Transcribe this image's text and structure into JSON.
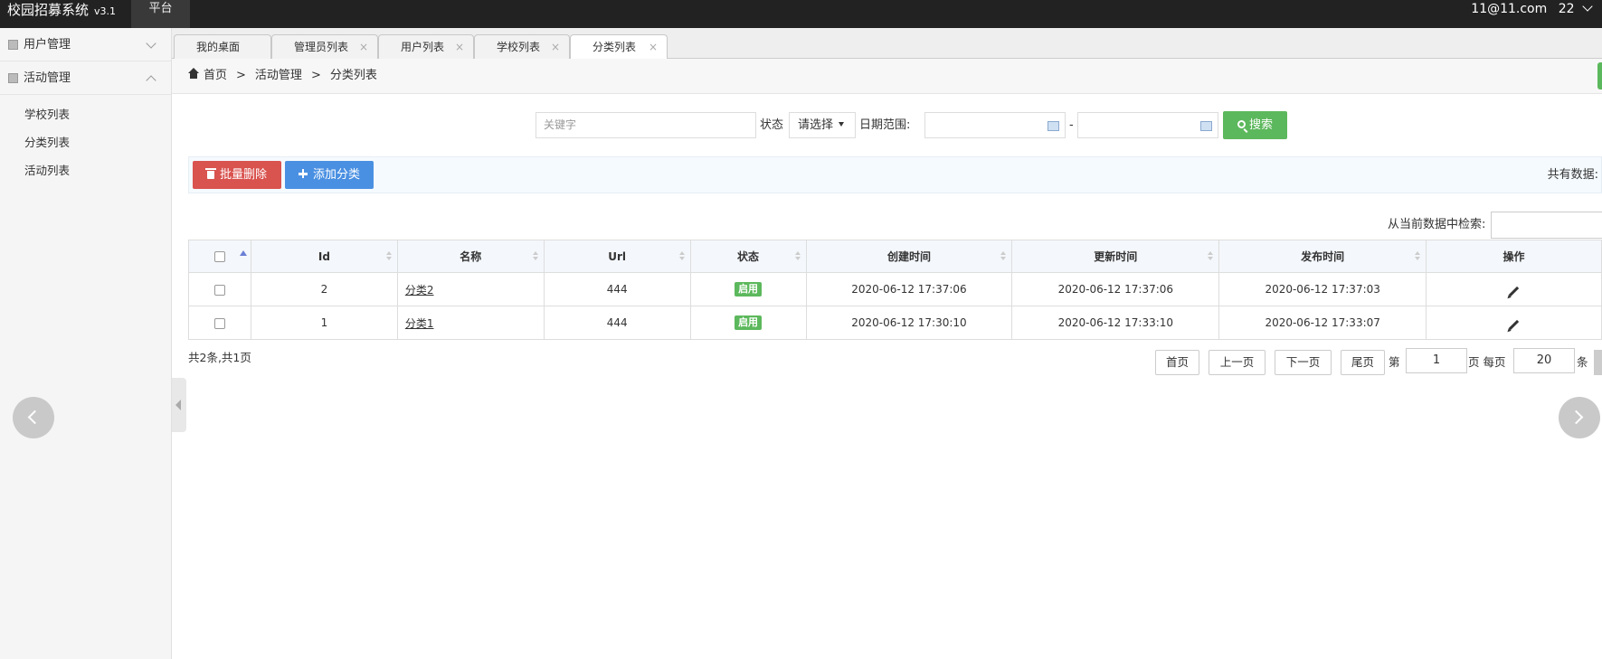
{
  "app": {
    "title": "校园招募系统",
    "version": "v3.1",
    "platform": "平台",
    "user": "11@11.com",
    "user_suffix": "22"
  },
  "sidebar": {
    "groups": [
      {
        "label": "用户管理",
        "expanded": false
      },
      {
        "label": "活动管理",
        "expanded": true,
        "items": [
          "学校列表",
          "分类列表",
          "活动列表"
        ]
      }
    ]
  },
  "tabs": [
    {
      "label": "我的桌面",
      "closable": false
    },
    {
      "label": "管理员列表",
      "closable": true,
      "close": "×"
    },
    {
      "label": "用户列表",
      "closable": true,
      "close": "×"
    },
    {
      "label": "学校列表",
      "closable": true,
      "close": "×"
    },
    {
      "label": "分类列表",
      "closable": true,
      "close": "×",
      "active": true
    }
  ],
  "breadcrumb": {
    "home": "首页",
    "sep": ">",
    "level1": "活动管理",
    "level2": "分类列表"
  },
  "search": {
    "keyword_placeholder": "关键字",
    "status_label": "状态",
    "status_value": "请选择",
    "date_label": "日期范围:",
    "date_sep": "-",
    "button": "搜索"
  },
  "actions": {
    "batch_delete": "批量删除",
    "add": "添加分类",
    "total_label": "共有数据:"
  },
  "filter": {
    "label": "从当前数据中检索:"
  },
  "table": {
    "headers": [
      "Id",
      "名称",
      "Url",
      "状态",
      "创建时间",
      "更新时间",
      "发布时间",
      "操作"
    ],
    "rows": [
      {
        "id": "2",
        "name": "分类2",
        "url": "444",
        "status": "启用",
        "created": "2020-06-12 17:37:06",
        "updated": "2020-06-12 17:37:06",
        "published": "2020-06-12 17:37:03"
      },
      {
        "id": "1",
        "name": "分类1",
        "url": "444",
        "status": "启用",
        "created": "2020-06-12 17:30:10",
        "updated": "2020-06-12 17:33:10",
        "published": "2020-06-12 17:33:07"
      }
    ]
  },
  "summary": "共2条,共1页",
  "pagination": {
    "first": "首页",
    "prev": "上一页",
    "next": "下一页",
    "last": "尾页",
    "page_prefix": "第",
    "page_value": "1",
    "page_suffix": "页 每页",
    "per_page_value": "20",
    "per_page_suffix": "条"
  },
  "colors": {
    "topbar": "#222222",
    "search_button": "#5cb85c",
    "delete_button": "#d9534f",
    "add_button": "#4a90e2",
    "badge": "#5cb85c"
  }
}
